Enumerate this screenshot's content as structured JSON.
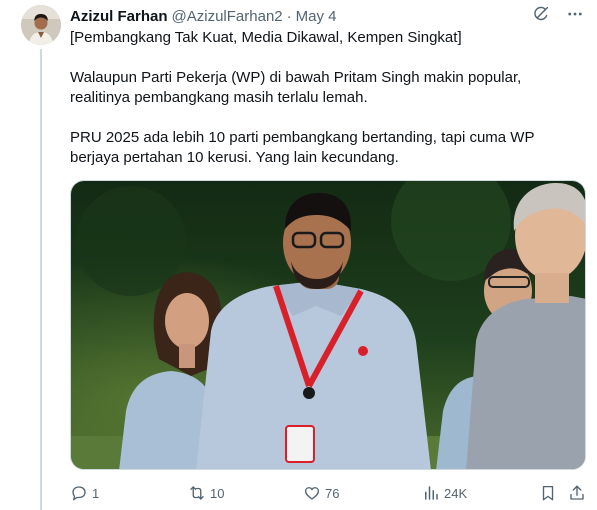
{
  "tweet": {
    "author_name": "Azizul Farhan",
    "handle": "@AzizulFarhan2",
    "separator": "·",
    "date": "May 4",
    "text_lines": [
      "[Pembangkang Tak Kuat, Media Dikawal, Kempen Singkat]",
      "Walaupun Parti Pekerja (WP) di bawah Pritam Singh makin popular,",
      "realitinya pembangkang masih terlalu lemah.",
      "PRU 2025 ada lebih 10 parti pembangkang bertanding, tapi cuma WP",
      "berjaya pertahan 10 kerusi. Yang lain kecundang."
    ]
  },
  "icons": {
    "grok": "grok-icon",
    "more": "more-icon",
    "reply": "reply-icon",
    "repost": "repost-icon",
    "like": "like-icon",
    "views": "views-icon",
    "bookmark": "bookmark-icon",
    "share": "share-icon"
  },
  "stats": {
    "replies": "1",
    "reposts": "10",
    "likes": "76",
    "views": "24K"
  },
  "colors": {
    "text": "#0f1419",
    "muted": "#536471",
    "border": "#cfd9de",
    "lanyard": "#d8202a"
  }
}
